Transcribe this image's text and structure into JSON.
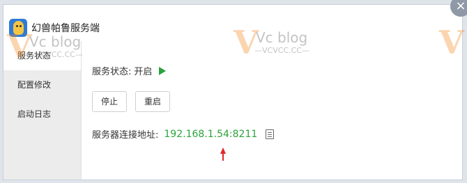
{
  "window": {
    "title": "幻兽帕鲁服务端",
    "close_symbol": "×"
  },
  "sidebar": {
    "items": [
      {
        "label": "服务状态",
        "active": true
      },
      {
        "label": "配置修改",
        "active": false
      },
      {
        "label": "启动日志",
        "active": false
      }
    ]
  },
  "status": {
    "label": "服务状态:",
    "value": "开启"
  },
  "buttons": {
    "stop": "停止",
    "restart": "重启"
  },
  "address": {
    "label": "服务器连接地址:",
    "value": "192.168.1.54:8211"
  },
  "watermark": {
    "logo": "V",
    "brand": "Vc blog",
    "site": "—VCVCC.CC—"
  },
  "colors": {
    "accent_green": "#2aa33a",
    "arrow_red": "#e0262b",
    "watermark_orange": "#f28a1f"
  }
}
